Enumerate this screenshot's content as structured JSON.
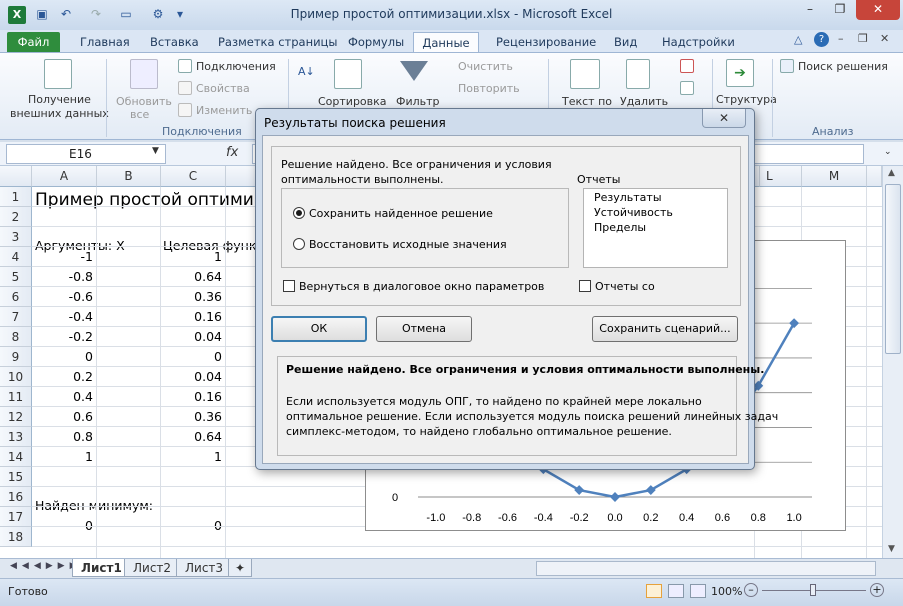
{
  "window": {
    "title": "Пример простой оптимизации.xlsx - Microsoft Excel",
    "close_label": "✕",
    "minimize_label": "–",
    "restore_label": "❐"
  },
  "tabs": [
    "Файл",
    "Главная",
    "Вставка",
    "Разметка страницы",
    "Формулы",
    "Данные",
    "Рецензирование",
    "Вид",
    "Надстройки"
  ],
  "ribbon": {
    "get_external": "Получение",
    "get_external2": "внешних данных",
    "refresh": "Обновить",
    "refresh2": "все",
    "connections": "Подключения",
    "properties": "Свойства",
    "edit_links": "Изменить с",
    "group_connections": "Подключения",
    "sort": "Сортировка",
    "filter": "Фильтр",
    "clear": "Очистить",
    "reapply": "Повторить",
    "text_to_cols": "Текст по",
    "remove_dups": "Удалить",
    "outline": "Структура",
    "solver": "Поиск решения",
    "group_analysis": "Анализ"
  },
  "formula_bar": {
    "name_box": "E16",
    "fx": "fx",
    "formula": ""
  },
  "columns": [
    "A",
    "B",
    "C",
    "L",
    "M"
  ],
  "rows": [
    "1",
    "2",
    "3",
    "4",
    "5",
    "6",
    "7",
    "8",
    "9",
    "10",
    "11",
    "12",
    "13",
    "14",
    "15",
    "16",
    "17",
    "18"
  ],
  "cells": {
    "title": "Пример простой оптими",
    "arg_header": "Аргументы: X",
    "target_header": "Целевая функц",
    "x_values": [
      "-1",
      "-0.8",
      "-0.6",
      "-0.4",
      "-0.2",
      "0",
      "0.2",
      "0.4",
      "0.6",
      "0.8",
      "1"
    ],
    "y_values": [
      "1",
      "0.64",
      "0.36",
      "0.16",
      "0.04",
      "0",
      "0.04",
      "0.16",
      "0.36",
      "0.64",
      "1"
    ],
    "found_min": "Найден минимум:",
    "min_x": "0",
    "min_y": "0"
  },
  "chart_data": {
    "type": "line",
    "x": [
      -1.0,
      -0.8,
      -0.6,
      -0.4,
      -0.2,
      0.0,
      0.2,
      0.4,
      0.6,
      0.8,
      1.0
    ],
    "values": [
      1,
      0.64,
      0.36,
      0.16,
      0.04,
      0,
      0.04,
      0.16,
      0.36,
      0.64,
      1
    ],
    "x_tick_labels": [
      "-1.0",
      "-0.8",
      "-0.6",
      "-0.4",
      "-0.2",
      "0.0",
      "0.2",
      "0.4",
      "0.6",
      "0.8",
      "1.0"
    ],
    "y_tick_labels": [
      "0"
    ],
    "series_color": "#4f81bd",
    "grid": true
  },
  "sheets": [
    "Лист1",
    "Лист2",
    "Лист3"
  ],
  "status": {
    "ready": "Готово",
    "zoom": "100%"
  },
  "dialog": {
    "title": "Результаты поиска решения",
    "close": "✕",
    "message_line1": "Решение найдено. Все ограничения и условия",
    "message_line2": "оптимальности выполнены.",
    "keep_solution": "Сохранить найденное решение",
    "restore_values": "Восстановить исходные значения",
    "reports_label": "Отчеты",
    "reports": [
      "Результаты",
      "Устойчивость",
      "Пределы"
    ],
    "return_to_params": "Вернуться в диалоговое окно параметров",
    "outline_reports": "Отчеты со",
    "ok": "ОК",
    "cancel": "Отмена",
    "save_scenario": "Сохранить сценарий...",
    "info_bold": "Решение найдено. Все ограничения и условия оптимальности выполнены.",
    "info_1": "Если используется модуль ОПГ, то найдено по крайней мере локально",
    "info_2": "оптимальное решение. Если используется модуль поиска решений линейных задач",
    "info_3": "симплекс-методом, то найдено глобально оптимальное решение."
  }
}
